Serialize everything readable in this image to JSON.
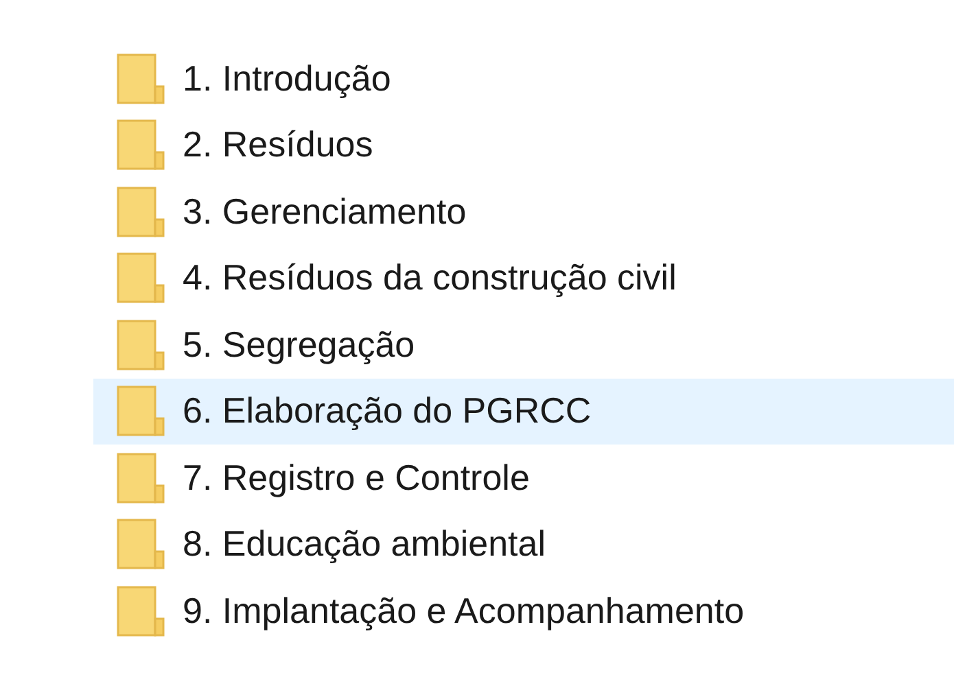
{
  "items": [
    {
      "label": "1. Introdução",
      "selected": false
    },
    {
      "label": "2. Resíduos",
      "selected": false
    },
    {
      "label": "3. Gerenciamento",
      "selected": false
    },
    {
      "label": "4. Resíduos da construção civil",
      "selected": false
    },
    {
      "label": "5. Segregação",
      "selected": false
    },
    {
      "label": "6. Elaboração do PGRCC",
      "selected": true
    },
    {
      "label": "7. Registro e Controle",
      "selected": false
    },
    {
      "label": "8. Educação ambiental",
      "selected": false
    },
    {
      "label": "9. Implantação e Acompanhamento",
      "selected": false
    }
  ]
}
